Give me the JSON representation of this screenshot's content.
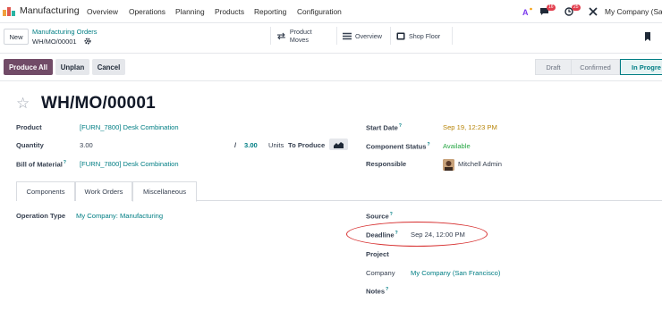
{
  "navbar": {
    "app_name": "Manufacturing",
    "menu": [
      "Overview",
      "Operations",
      "Planning",
      "Products",
      "Reporting",
      "Configuration"
    ],
    "chat_count": "16",
    "activity_count": "25",
    "company": "My Company (San"
  },
  "controlbar": {
    "new_label": "New",
    "breadcrumb_parent": "Manufacturing Orders",
    "breadcrumb_current": "WH/MO/00001",
    "smart_buttons": [
      "Product Moves",
      "Overview",
      "Shop Floor"
    ]
  },
  "actions": {
    "produce_all": "Produce All",
    "unplan": "Unplan",
    "cancel": "Cancel"
  },
  "stages": [
    "Draft",
    "Confirmed",
    "In Progre"
  ],
  "record": {
    "title": "WH/MO/00001",
    "product_label": "Product",
    "product_value": "[FURN_7800] Desk Combination",
    "quantity_label": "Quantity",
    "quantity_value": "3.00",
    "quantity_sep": "/",
    "quantity_target": "3.00",
    "units_label": "Units",
    "to_produce": "To Produce",
    "bom_label": "Bill of Material",
    "bom_value": "[FURN_7800] Desk Combination",
    "start_label": "Start Date",
    "start_value": "Sep 19, 12:23 PM",
    "component_label": "Component Status",
    "component_value": "Available",
    "responsible_label": "Responsible",
    "responsible_value": "Mitchell Admin"
  },
  "tabs": [
    "Components",
    "Work Orders",
    "Miscellaneous"
  ],
  "misc": {
    "operation_type_label": "Operation Type",
    "operation_type_value": "My Company: Manufacturing",
    "source_label": "Source",
    "deadline_label": "Deadline",
    "deadline_value": "Sep 24, 12:00 PM",
    "project_label": "Project",
    "company_label": "Company",
    "company_value": "My Company (San Francisco)",
    "notes_label": "Notes"
  },
  "colors": {
    "brand": "#714b67",
    "link": "#017e84",
    "annotation": "#d62c2c",
    "date_warning": "#b8860b",
    "available": "#28a745"
  },
  "tooltip_marker": "?"
}
